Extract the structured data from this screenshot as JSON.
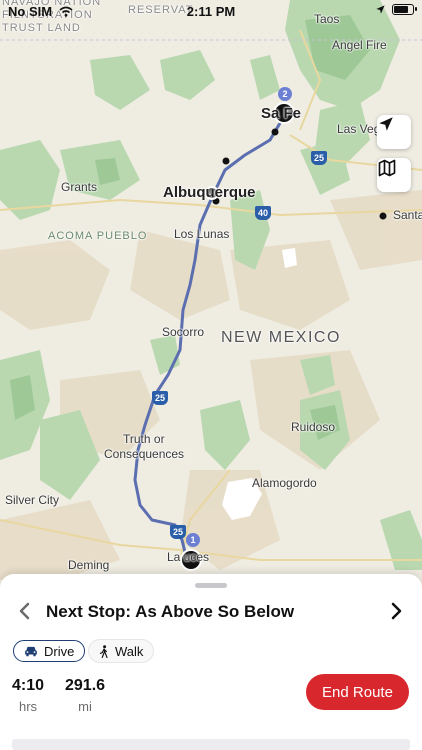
{
  "status_bar": {
    "carrier": "No SIM",
    "time": "2:11 PM",
    "battery_level": 0.7
  },
  "map": {
    "labels": {
      "top_left_1": "NAVAJO NATION",
      "top_left_2": "FILNTSRATION",
      "top_left_3": "TRUST LAND",
      "reservation": "RESERVAT",
      "taos": "Taos",
      "angel_fire": "Angel Fire",
      "santa_fe": "Sa   Fe",
      "las_vegas": "Las Veg",
      "grants": "Grants",
      "albuquerque": "Albuquerque",
      "acoma": "ACOMA PUEBLO",
      "los_lunas": "Los Lunas",
      "santa": "Santa",
      "socorro": "Socorro",
      "new_mexico": "NEW MEXICO",
      "truth_1": "Truth or",
      "truth_2": "Consequences",
      "ruidoso": "Ruidoso",
      "alamogordo": "Alamogordo",
      "silver_city": "Silver City",
      "deming": "Deming",
      "las_cruces": "La   uces"
    },
    "highways": {
      "i25_north": "25",
      "i40": "40",
      "i25_mid": "25",
      "i25_south": "25"
    },
    "stop_markers": {
      "stop_1": "1",
      "stop_2": "2"
    },
    "colors": {
      "route": "#5b6fb0",
      "stop_badge": "#6c7fd2"
    }
  },
  "icons": {
    "locate": "location-arrow-icon",
    "map_mode": "map-icon"
  },
  "sheet": {
    "next_stop": "Next Stop: As Above So Below",
    "modes": [
      {
        "label": "Drive",
        "icon": "car-icon",
        "active": true
      },
      {
        "label": "Walk",
        "icon": "walk-icon",
        "active": false
      }
    ],
    "stats": [
      {
        "value": "4:10",
        "unit": "hrs"
      },
      {
        "value": "291.6",
        "unit": "mi"
      }
    ],
    "end_route_label": "End Route",
    "colors": {
      "end_route": "#d9272e",
      "active_mode_border": "#1f3f73"
    }
  }
}
